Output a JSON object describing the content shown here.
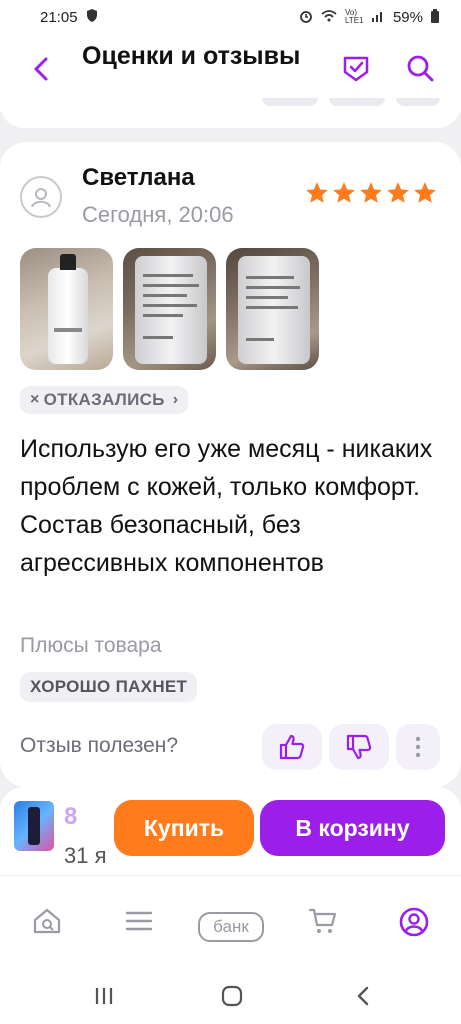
{
  "status_bar": {
    "time": "21:05",
    "battery": "59%",
    "network": "Vo) LTE1"
  },
  "header": {
    "title": "Оценки и отзывы"
  },
  "review": {
    "author": "Светлана",
    "date": "Сегодня, 20:06",
    "rating": 5,
    "status_tag": "ОТКАЗАЛИСЬ",
    "text": "Использую его уже месяц - никаких проблем с кожей, только комфорт.  Состав безопасный, без агрессивных компонентов",
    "pros_label": "Плюсы товара",
    "pros_tag": "ХОРОШО ПАХНЕТ",
    "useful_label": "Отзыв полезен?"
  },
  "buy_bar": {
    "price_partial": "8",
    "date_partial": "31 я",
    "buy_label": "Купить",
    "cart_label": "В корзину"
  },
  "tabbar": {
    "bank_label": "банк"
  },
  "colors": {
    "accent": "#9b1fe8",
    "orange": "#ff7b1c",
    "star": "#ff7b1c"
  }
}
